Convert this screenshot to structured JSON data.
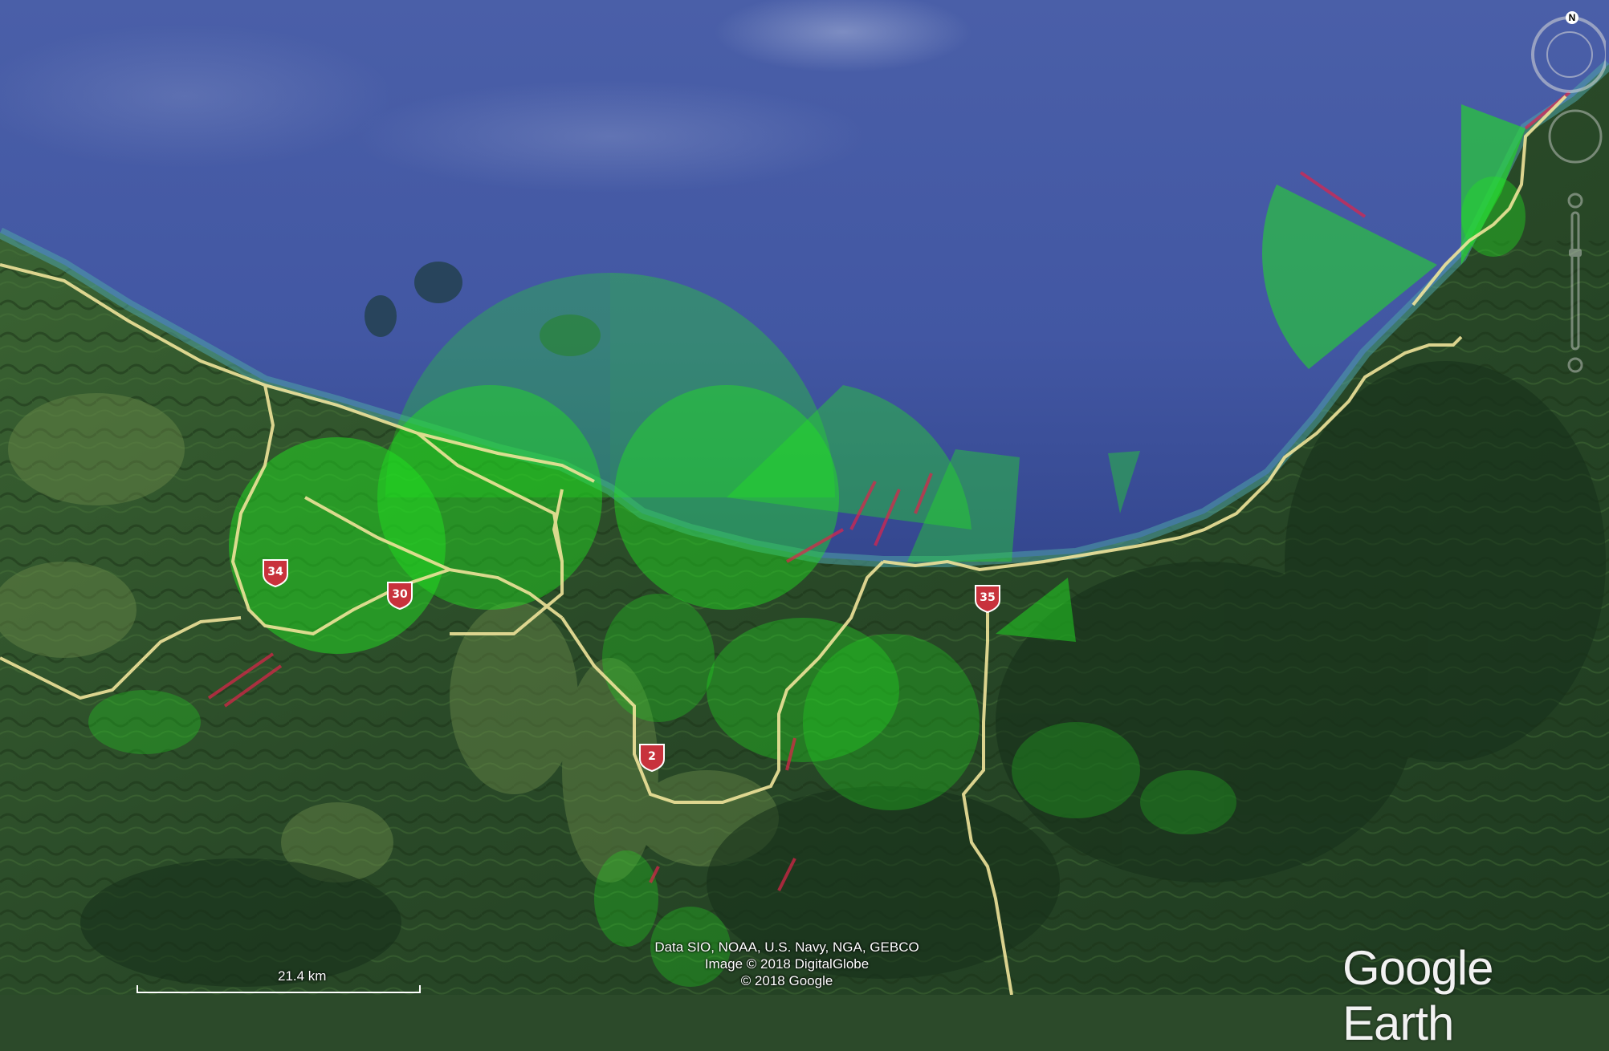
{
  "attribution": {
    "line1": "Data SIO, NOAA, U.S. Navy, NGA, GEBCO",
    "line2": "Image © 2018 DigitalGlobe",
    "line3": "© 2018 Google"
  },
  "scale": {
    "label": "21.4 km"
  },
  "logo": {
    "text": "Google Earth"
  },
  "compass": {
    "north_label": "N"
  },
  "route_shields": [
    {
      "number": "34"
    },
    {
      "number": "30"
    },
    {
      "number": "2"
    },
    {
      "number": "35"
    }
  ],
  "colors": {
    "ocean": "#3e57a6",
    "land": "#2e4a2a",
    "road": "#efe39a",
    "coverage": "#22e022",
    "no_coverage": "#e0234a",
    "shield": "#c8323c"
  }
}
